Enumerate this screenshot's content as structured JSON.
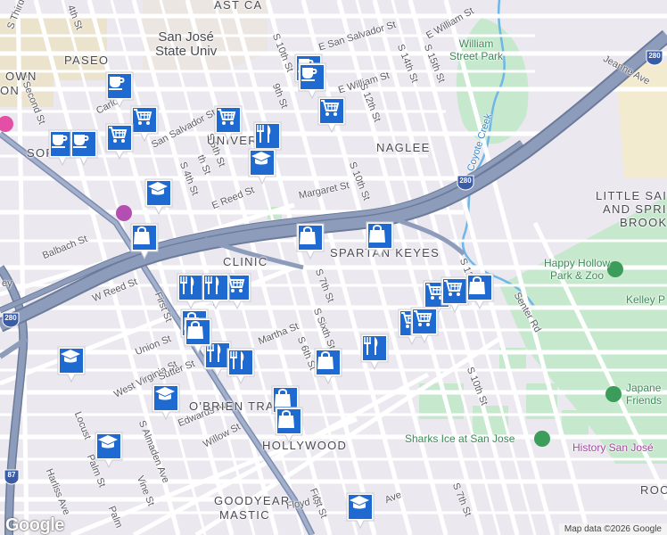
{
  "colors": {
    "land": "#ebe8ef",
    "street": "#ffffff",
    "highway": "#8494b3",
    "highway_edge": "#6b7b99",
    "park": "#c6e8cc",
    "campus": "#e6dcc6",
    "water": "#5ab0e6",
    "marker": "#1e6ad0",
    "shield": "#3a5ba8"
  },
  "streets": [
    {
      "label": "S Third St"
    },
    {
      "label": "S Second St"
    },
    {
      "label": "4th St"
    },
    {
      "label": "E San Salvador St"
    },
    {
      "label": "S 10th St"
    },
    {
      "label": "E William St"
    },
    {
      "label": "E William St"
    },
    {
      "label": "S 14th St"
    },
    {
      "label": "S 15th St"
    },
    {
      "label": "Jeanne Ave"
    },
    {
      "label": "9th St"
    },
    {
      "label": "S 12th St"
    },
    {
      "label": "San Salvador St"
    },
    {
      "label": "S 4th St"
    },
    {
      "label": "S 5th St"
    },
    {
      "label": "th St"
    },
    {
      "label": "S 10th St"
    },
    {
      "label": "E Reed St"
    },
    {
      "label": "Margaret St"
    },
    {
      "label": "Balbach St"
    },
    {
      "label": "W Reed St"
    },
    {
      "label": "S 7th St"
    },
    {
      "label": "First St"
    },
    {
      "label": "Union St"
    },
    {
      "label": "West Virginia St"
    },
    {
      "label": "Sutter St"
    },
    {
      "label": "Martha St"
    },
    {
      "label": "S 6th St"
    },
    {
      "label": "S Sixth St"
    },
    {
      "label": "Edwards Ave"
    },
    {
      "label": "Willow St"
    },
    {
      "label": "S 10th St"
    },
    {
      "label": "Senter Rd"
    },
    {
      "label": "S Almaden Ave"
    },
    {
      "label": "Vine St"
    },
    {
      "label": "Palm St"
    },
    {
      "label": "Harliss Ave"
    },
    {
      "label": "Locust"
    },
    {
      "label": "Floyd St"
    },
    {
      "label": "First St"
    },
    {
      "label": "S 7th St"
    },
    {
      "label": "S 12"
    },
    {
      "label": "Carlos"
    },
    {
      "label": "ey"
    },
    {
      "label": "Coyote Creek"
    },
    {
      "label": "Palm"
    },
    {
      "label": "Ave"
    },
    {
      "label": "St"
    }
  ],
  "neighborhoods": [
    {
      "label": "PASEO"
    },
    {
      "label": "NAGLEE"
    },
    {
      "label": "CLINIC"
    },
    {
      "label": "SPARTAN KEYES"
    },
    {
      "label": "O'BRIEN TRACT"
    },
    {
      "label": "HOLLYWOOD"
    },
    {
      "label": "GOODYEAR"
    },
    {
      "label": "MASTIC"
    },
    {
      "label": "LITTLE SAIG"
    },
    {
      "label": "AND SPRIN"
    },
    {
      "label": "BROOK"
    },
    {
      "label": "UNIVER"
    },
    {
      "label": "OWN"
    },
    {
      "label": "SOF"
    },
    {
      "label": "ROC"
    },
    {
      "label": "AST CA"
    },
    {
      "label": "ON"
    }
  ],
  "places": [
    {
      "label": "San José\nState Univ"
    },
    {
      "label": "William\nStreet Park"
    },
    {
      "label": "Happy Hollow\nPark & Zoo"
    },
    {
      "label": "Kelley P"
    },
    {
      "label": "Japane\nFriends"
    },
    {
      "label": "Sharks Ice at San Jose"
    },
    {
      "label": "History San José"
    }
  ],
  "shields": [
    {
      "label": "280"
    },
    {
      "label": "280"
    },
    {
      "label": "280"
    },
    {
      "label": "87"
    }
  ],
  "markers": [
    {
      "icon": "coffee-icon"
    },
    {
      "icon": "coffee-icon"
    },
    {
      "icon": "coffee-icon"
    },
    {
      "icon": "coffee-icon"
    },
    {
      "icon": "coffee-icon"
    },
    {
      "icon": "cart-icon"
    },
    {
      "icon": "cart-icon"
    },
    {
      "icon": "cart-icon"
    },
    {
      "icon": "cart-icon"
    },
    {
      "icon": "cart-icon"
    },
    {
      "icon": "cart-icon"
    },
    {
      "icon": "cart-icon"
    },
    {
      "icon": "cart-icon"
    },
    {
      "icon": "cart-icon"
    },
    {
      "icon": "restaurant-icon"
    },
    {
      "icon": "restaurant-icon"
    },
    {
      "icon": "restaurant-icon"
    },
    {
      "icon": "restaurant-icon"
    },
    {
      "icon": "restaurant-icon"
    },
    {
      "icon": "restaurant-icon"
    },
    {
      "icon": "school-icon"
    },
    {
      "icon": "school-icon"
    },
    {
      "icon": "school-icon"
    },
    {
      "icon": "school-icon"
    },
    {
      "icon": "school-icon"
    },
    {
      "icon": "school-icon"
    },
    {
      "icon": "shopping-bag-icon"
    },
    {
      "icon": "shopping-bag-icon"
    },
    {
      "icon": "shopping-bag-icon"
    },
    {
      "icon": "shopping-bag-icon"
    },
    {
      "icon": "shopping-bag-icon"
    },
    {
      "icon": "shopping-bag-icon"
    },
    {
      "icon": "shopping-bag-icon"
    },
    {
      "icon": "shopping-bag-icon"
    },
    {
      "icon": "shopping-bag-icon"
    }
  ],
  "logo": "Google",
  "attribution": "Map data ©2026 Google"
}
